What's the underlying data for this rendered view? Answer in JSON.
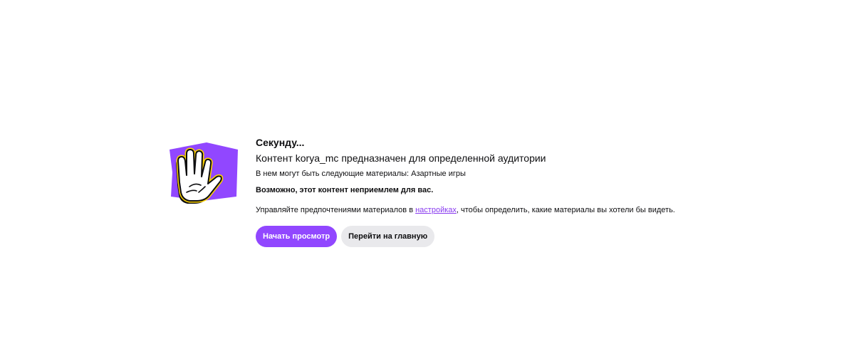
{
  "gate": {
    "title": "Секунду...",
    "subtitle_prefix": "Контент ",
    "channel_name": "korya_mc",
    "subtitle_suffix": " предназначен для определенной аудитории",
    "materials_text": "В нем могут быть следующие материалы: Азартные игры",
    "warning_text": "Возможно, этот контент неприемлем для вас.",
    "manage_prefix": "Управляйте предпочтениями материалов в ",
    "manage_link": "настройках",
    "manage_suffix": ", чтобы определить, какие материалы вы хотели бы видеть.",
    "start_button": "Начать просмотр",
    "home_button": "Перейти на главную"
  },
  "colors": {
    "accent": "#9147ff",
    "link": "#8839ef",
    "secondary_button": "#e9e9ec",
    "hand_outline": "#ffd400"
  },
  "icons": {
    "illustration": "raised-hand-icon"
  }
}
